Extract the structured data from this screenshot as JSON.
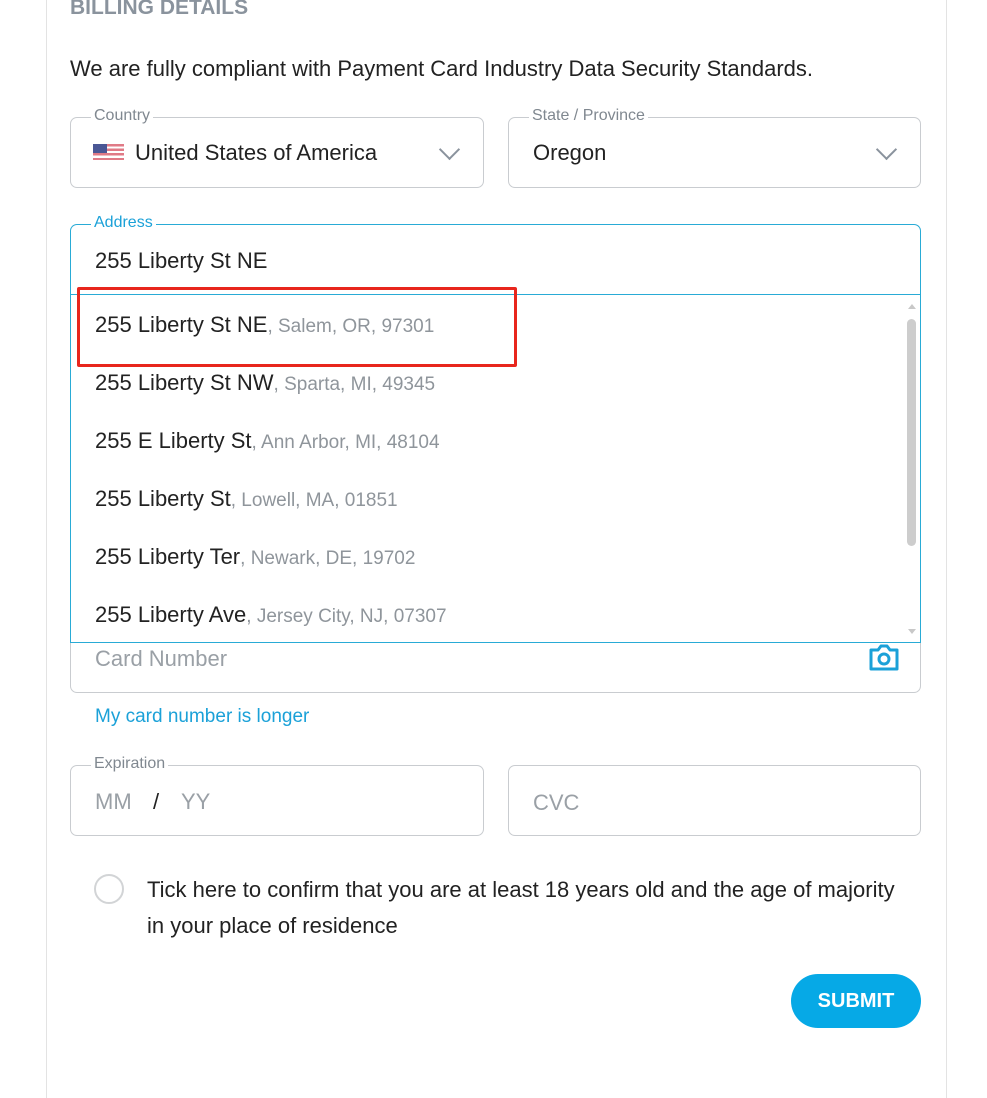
{
  "section_title": "BILLING DETAILS",
  "intro": "We are fully compliant with Payment Card Industry Data Security Standards.",
  "country": {
    "label": "Country",
    "value": "United States of America",
    "flag": "us-flag-icon"
  },
  "state": {
    "label": "State / Province",
    "value": "Oregon"
  },
  "address": {
    "label": "Address",
    "value": "255 Liberty St NE",
    "suggestions": [
      {
        "main": "255 Liberty St NE",
        "sub": ", Salem, OR, 97301"
      },
      {
        "main": "255 Liberty St NW",
        "sub": ", Sparta, MI, 49345"
      },
      {
        "main": "255 E Liberty St",
        "sub": ", Ann Arbor, MI, 48104"
      },
      {
        "main": "255 Liberty St",
        "sub": ", Lowell, MA, 01851"
      },
      {
        "main": "255 Liberty Ter",
        "sub": ", Newark, DE, 19702"
      },
      {
        "main": "255 Liberty Ave",
        "sub": ", Jersey City, NJ, 07307"
      }
    ]
  },
  "card": {
    "placeholder": "Card Number",
    "longer_link": "My card number is longer"
  },
  "expiration": {
    "label": "Expiration",
    "mm": "MM",
    "sep": "/",
    "yy": "YY"
  },
  "cvc": {
    "placeholder": "CVC"
  },
  "age_confirm": "Tick here to confirm that you are at least 18 years old and the age of majority in your place of residence",
  "submit": "SUBMIT",
  "colors": {
    "accent": "#06a9e6",
    "highlight": "#e8261d"
  }
}
